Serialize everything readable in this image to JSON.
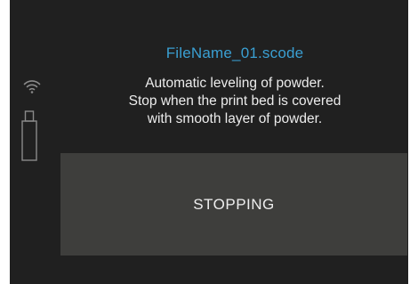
{
  "header": {
    "file_name": "FileName_01.scode"
  },
  "message": {
    "lines": [
      "Automatic leveling of powder.",
      "Stop when the print bed is covered",
      "with smooth layer of powder."
    ]
  },
  "status_button": {
    "label": "STOPPING"
  },
  "sidebar": {
    "icons": [
      "wifi-icon",
      "usb-drive-icon"
    ]
  },
  "colors": {
    "background": "#202020",
    "accent": "#3a9fd2",
    "button": "#3e3e3c",
    "text": "#ececec",
    "icon": "#8a8a8a"
  }
}
